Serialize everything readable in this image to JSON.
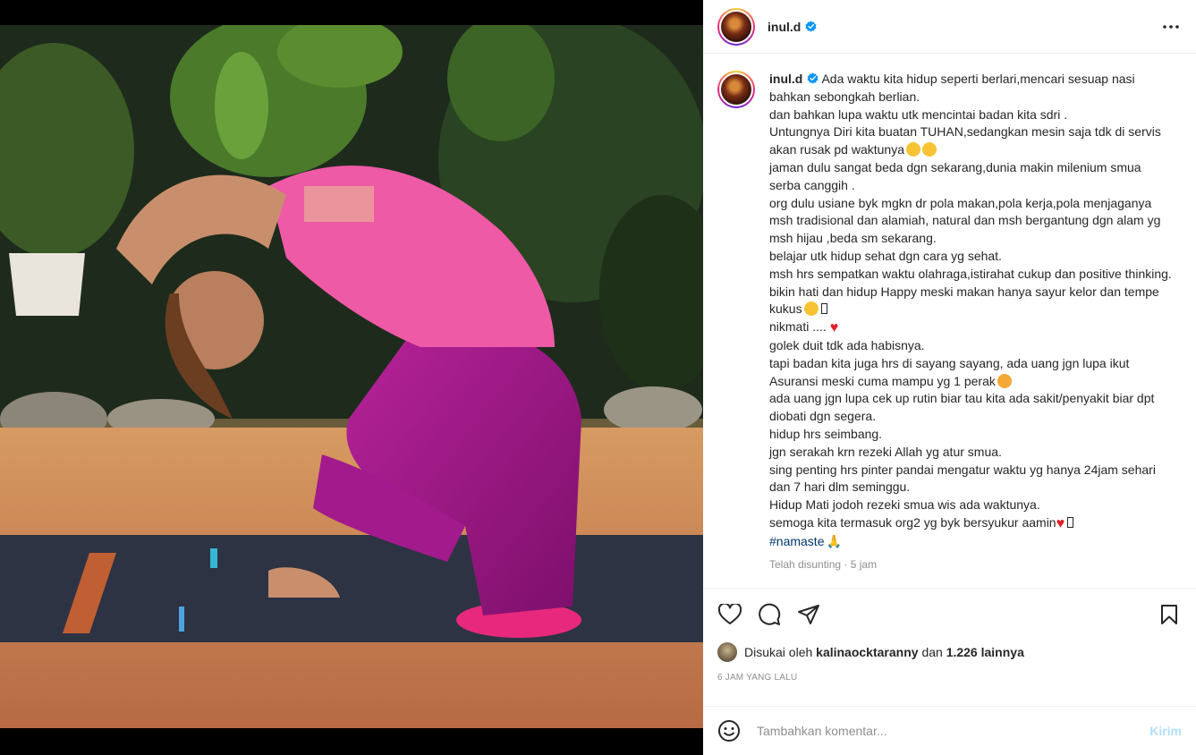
{
  "post": {
    "username": "inul.d",
    "verified_icon": "verified-badge-icon",
    "more_icon": "more-options-icon",
    "caption_lines": [
      "Ada waktu kita hidup seperti berlari,mencari sesuap nasi bahkan sebongkah berlian.",
      "dan bahkan lupa waktu utk mencintai badan kita sdri .",
      "Untungnya Diri kita buatan TUHAN,sedangkan mesin saja tdk di servis akan rusak pd waktunya",
      "jaman dulu sangat beda dgn sekarang,dunia makin milenium smua serba canggih .",
      "org dulu usiane byk mgkn dr pola makan,pola kerja,pola menjaganya msh tradisional dan alamiah, natural dan msh bergantung dgn alam yg msh hijau ,beda sm sekarang.",
      "belajar utk hidup sehat dgn cara yg sehat.",
      "msh hrs sempatkan waktu olahraga,istirahat cukup dan positive thinking.",
      "bikin hati dan hidup Happy meski makan hanya sayur kelor dan tempe kukus",
      "nikmati ....",
      "golek duit tdk ada habisnya.",
      "tapi badan kita juga hrs di sayang sayang, ada uang jgn lupa ikut Asuransi meski cuma mampu yg 1 perak",
      "ada uang jgn lupa cek up rutin biar tau kita ada sakit/penyakit biar dpt diobati dgn segera.",
      "hidup hrs seimbang.",
      "jgn serakah krn rezeki Allah yg atur smua.",
      "sing penting hrs pinter pandai mengatur waktu yg hanya 24jam sehari dan 7 hari dlm seminggu.",
      "Hidup Mati jodoh rezeki smua wis ada waktunya.",
      "semoga kita termasuk org2 yg byk bersyukur aamin"
    ],
    "hashtag": "#namaste",
    "edited_label": "Telah disunting · 5 jam"
  },
  "actions": {
    "like_icon": "heart-icon",
    "comment_icon": "comment-icon",
    "share_icon": "share-icon",
    "save_icon": "bookmark-icon"
  },
  "likes": {
    "prefix": "Disukai oleh",
    "user": "kalinaocktaranny",
    "conj": "dan",
    "others": "1.226 lainnya"
  },
  "timestamp": "6 JAM YANG LALU",
  "comment": {
    "emoji_icon": "emoji-icon",
    "placeholder": "Tambahkan komentar...",
    "post_label": "Kirim"
  },
  "colors": {
    "link": "#00376b",
    "post_button_disabled": "#b2dffc",
    "heart": "#e0202a"
  }
}
